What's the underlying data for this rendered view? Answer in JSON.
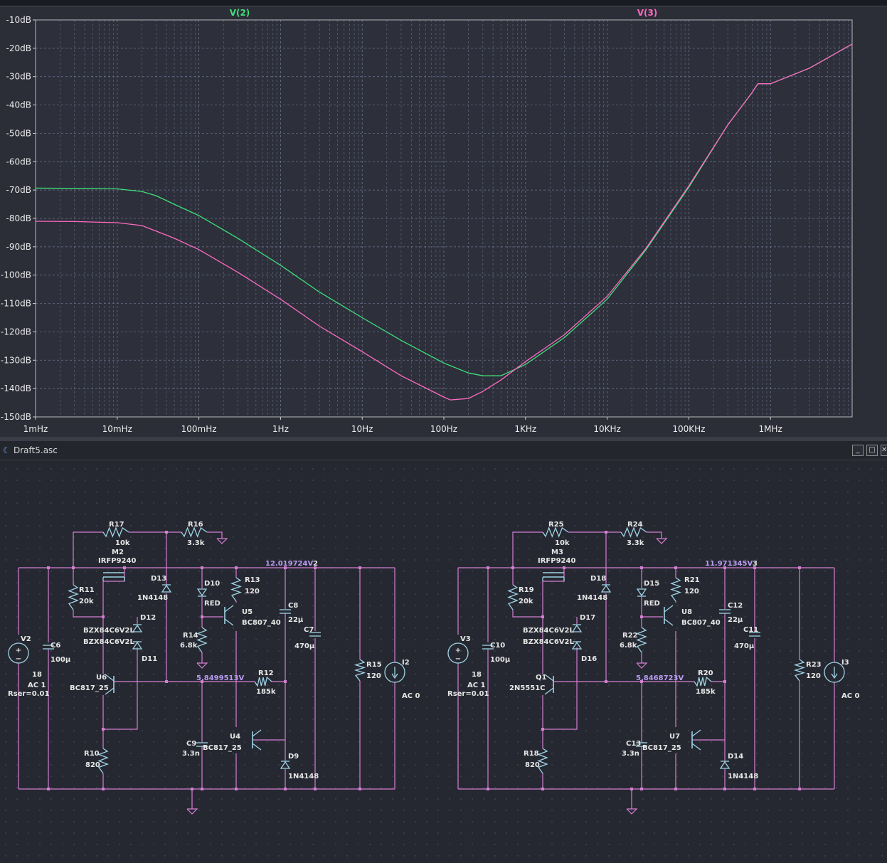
{
  "plot": {
    "traces": [
      {
        "name": "V(2)",
        "color": "#3ee07a"
      },
      {
        "name": "V(3)",
        "color": "#ff6ac1"
      }
    ],
    "chart_data": {
      "type": "line",
      "xscale": "log",
      "xlim": [
        0.001,
        10000000
      ],
      "ylim": [
        -150,
        -10
      ],
      "grid": true,
      "x_tick_labels": [
        "1mHz",
        "10mHz",
        "100mHz",
        "1Hz",
        "10Hz",
        "100Hz",
        "1KHz",
        "10KHz",
        "100KHz",
        "1MHz"
      ],
      "y_tick_labels": [
        "-10dB",
        "-20dB",
        "-30dB",
        "-40dB",
        "-50dB",
        "-60dB",
        "-70dB",
        "-80dB",
        "-90dB",
        "-100dB",
        "-110dB",
        "-120dB",
        "-130dB",
        "-140dB",
        "-150dB"
      ],
      "series": [
        {
          "name": "V(2)",
          "color": "#3ee07a",
          "x": [
            0.001,
            0.003,
            0.01,
            0.02,
            0.03,
            0.05,
            0.1,
            0.3,
            1,
            3,
            10,
            30,
            100,
            200,
            300,
            500,
            1000,
            3000,
            10000,
            30000,
            100000,
            300000,
            600000,
            700000,
            1000000,
            3000000,
            10000000
          ],
          "y": [
            -69.3,
            -69.4,
            -69.6,
            -70.5,
            -72,
            -75,
            -79,
            -87,
            -96.5,
            -106,
            -115,
            -123,
            -131,
            -134.5,
            -135.5,
            -135.5,
            -131.5,
            -122,
            -108.5,
            -91,
            -69,
            -47,
            -35.5,
            -32.5,
            -32.5,
            -27,
            -18.5
          ]
        },
        {
          "name": "V(3)",
          "color": "#ff6ac1",
          "x": [
            0.001,
            0.003,
            0.01,
            0.02,
            0.03,
            0.05,
            0.1,
            0.3,
            1,
            3,
            10,
            30,
            100,
            120,
            200,
            300,
            500,
            1000,
            3000,
            10000,
            30000,
            100000,
            300000,
            600000,
            700000,
            1000000,
            3000000,
            10000000
          ],
          "y": [
            -81,
            -81.1,
            -81.5,
            -82.5,
            -84.5,
            -87,
            -91,
            -99,
            -108.5,
            -118,
            -127,
            -135.5,
            -143,
            -144,
            -143.5,
            -141,
            -137,
            -130.5,
            -121,
            -107.5,
            -90.5,
            -68.5,
            -47,
            -35.5,
            -32.5,
            -32.5,
            -27,
            -18.5
          ]
        }
      ]
    }
  },
  "schematic": {
    "window_title": "Draft5.asc",
    "buttons": {
      "minimize": "_",
      "maximize": "□",
      "close": "✕"
    },
    "left": {
      "net_labels": {
        "rail": "12.019724V",
        "rail_node": "2",
        "mid": "5.8499513V"
      },
      "source": {
        "ref": "V2",
        "value": "18",
        "ac": "AC 1",
        "rser": "Rser=0.01"
      },
      "components": [
        {
          "ref": "R17",
          "value": "10k"
        },
        {
          "ref": "R16",
          "value": "3.3k"
        },
        {
          "ref": "M2",
          "value": "IRFP9240"
        },
        {
          "ref": "R11",
          "value": "20k"
        },
        {
          "ref": "D13",
          "value": "1N4148"
        },
        {
          "ref": "D10",
          "value": "RED"
        },
        {
          "ref": "R13",
          "value": "120"
        },
        {
          "ref": "U5",
          "value": "BC807_40"
        },
        {
          "ref": "C8",
          "value": "22µ"
        },
        {
          "ref": "C7",
          "value": "470µ"
        },
        {
          "ref": "D12",
          "value": "BZX84C6V2L"
        },
        {
          "ref": "D11",
          "value": "BZX84C6V2L"
        },
        {
          "ref": "C6",
          "value": "100µ"
        },
        {
          "ref": "U6",
          "value": "BC817_25"
        },
        {
          "ref": "R14",
          "value": "6.8k"
        },
        {
          "ref": "R12",
          "value": "185k"
        },
        {
          "ref": "R15",
          "value": "120"
        },
        {
          "ref": "I2",
          "value": "AC 0"
        },
        {
          "ref": "U4",
          "value": "BC817_25"
        },
        {
          "ref": "C9",
          "value": "3.3n"
        },
        {
          "ref": "D9",
          "value": "1N4148"
        },
        {
          "ref": "R10",
          "value": "820"
        }
      ]
    },
    "right": {
      "net_labels": {
        "rail": "11.971345V",
        "rail_node": "3",
        "mid": "5.8468723V"
      },
      "source": {
        "ref": "V3",
        "value": "18",
        "ac": "AC 1",
        "rser": "Rser=0.01"
      },
      "components": [
        {
          "ref": "R25",
          "value": "10k"
        },
        {
          "ref": "R24",
          "value": "3.3k"
        },
        {
          "ref": "M3",
          "value": "IRFP9240"
        },
        {
          "ref": "R19",
          "value": "20k"
        },
        {
          "ref": "D18",
          "value": "1N4148"
        },
        {
          "ref": "D15",
          "value": "RED"
        },
        {
          "ref": "R21",
          "value": "120"
        },
        {
          "ref": "U8",
          "value": "BC807_40"
        },
        {
          "ref": "C12",
          "value": "22µ"
        },
        {
          "ref": "C11",
          "value": "470µ"
        },
        {
          "ref": "D17",
          "value": "BZX84C6V2L"
        },
        {
          "ref": "D16",
          "value": "BZX84C6V2L"
        },
        {
          "ref": "C10",
          "value": "100µ"
        },
        {
          "ref": "Q1",
          "value": "2N5551C"
        },
        {
          "ref": "R22",
          "value": "6.8k"
        },
        {
          "ref": "R20",
          "value": "185k"
        },
        {
          "ref": "R23",
          "value": "120"
        },
        {
          "ref": "I3",
          "value": "AC 0"
        },
        {
          "ref": "U7",
          "value": "BC817_25"
        },
        {
          "ref": "C13",
          "value": "3.3n"
        },
        {
          "ref": "D14",
          "value": "1N4148"
        },
        {
          "ref": "R18",
          "value": "820"
        }
      ]
    }
  }
}
